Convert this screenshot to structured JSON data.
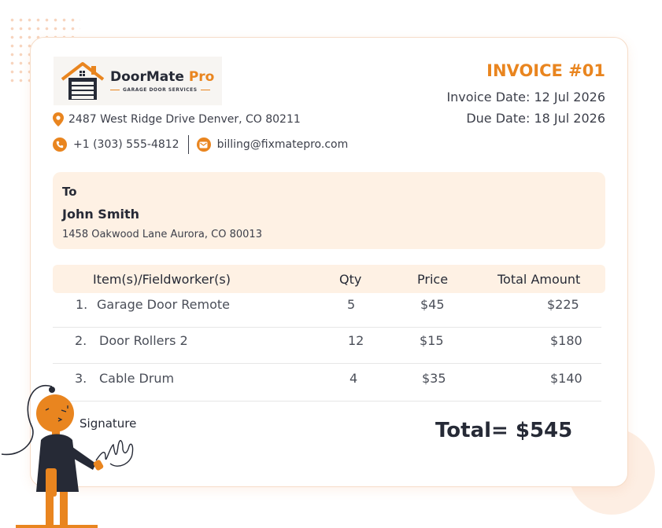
{
  "company": {
    "brand_main": "DoorMate",
    "brand_accent": "Pro",
    "tagline": "GARAGE DOOR SERVICES",
    "address": "2487 West Ridge Drive Denver, CO 80211",
    "phone": "+1 (303) 555-4812",
    "email": "billing@fixmatepro.com"
  },
  "invoice": {
    "title": "INVOICE #01",
    "invoice_date": "Invoice Date: 12 Jul 2026",
    "due_date": "Due Date: 18 Jul 2026"
  },
  "recipient": {
    "label": "To",
    "name": "John Smith",
    "address": "1458 Oakwood Lane Aurora, CO 80013"
  },
  "table": {
    "headers": [
      "Item(s)/Fieldworker(s)",
      "Qty",
      "Price",
      "Total Amount"
    ],
    "rows": [
      {
        "num": "1.",
        "item": "Garage Door Remote",
        "qty": "5",
        "price": "$45",
        "total": "$225"
      },
      {
        "num": "2.",
        "item": "Door Rollers 2",
        "qty": "12",
        "price": "$15",
        "total": "$180"
      },
      {
        "num": "3.",
        "item": "Cable Drum",
        "qty": "4",
        "price": "$35",
        "total": "$140"
      }
    ]
  },
  "signature_label": "Signature",
  "total": "Total= $545",
  "colors": {
    "accent": "#e9851f",
    "panel": "#fef1e4",
    "text": "#262a36"
  },
  "icons": [
    "house-logo-icon",
    "location-pin-icon",
    "phone-icon",
    "mail-icon",
    "person-illustration"
  ]
}
